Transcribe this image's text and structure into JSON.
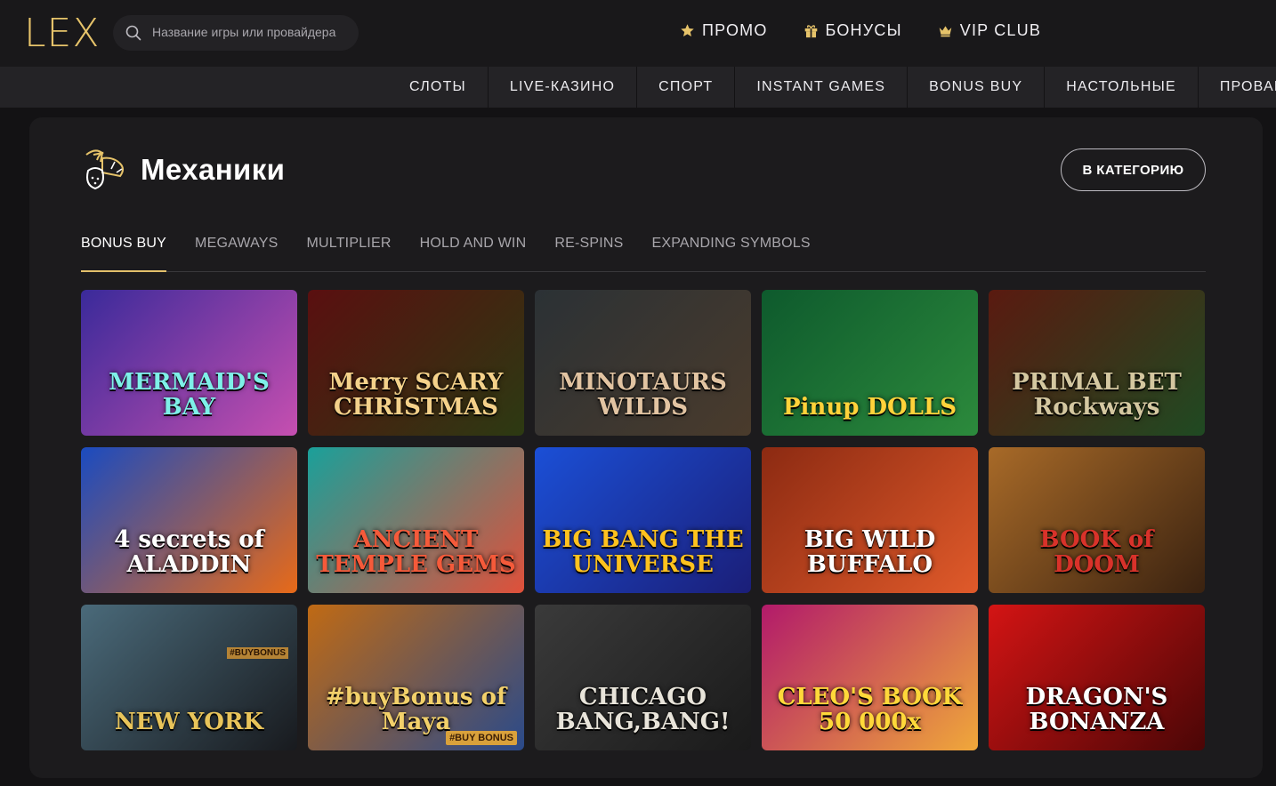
{
  "header": {
    "logo": "LEX",
    "search_placeholder": "Название игры или провайдера",
    "nav": [
      {
        "label": "ПРОМО",
        "icon": "star-icon"
      },
      {
        "label": "БОНУСЫ",
        "icon": "gift-icon"
      },
      {
        "label": "VIP CLUB",
        "icon": "crown-icon"
      }
    ],
    "accent": "#e6c36a"
  },
  "categories": [
    "СЛОТЫ",
    "LIVE-КАЗИНО",
    "СПОРТ",
    "INSTANT GAMES",
    "BONUS BUY",
    "НАСТОЛЬНЫЕ",
    "ПРОВАЙДЕ"
  ],
  "section": {
    "title": "Механики",
    "icon": "mechanics-fruit-icon",
    "category_button": "В КАТЕГОРИЮ",
    "tabs": [
      "BONUS BUY",
      "MEGAWAYS",
      "MULTIPLIER",
      "HOLD AND WIN",
      "RE-SPINS",
      "EXPANDING SYMBOLS"
    ],
    "active_tab": "BONUS BUY"
  },
  "games": [
    {
      "title": "MERMAID'S BAY",
      "bg1": "#3a2a9a",
      "bg2": "#c64fb0",
      "text": "#7ef0e8"
    },
    {
      "title": "Merry SCARY CHRISTMAS",
      "bg1": "#5a0f10",
      "bg2": "#2c3a12",
      "text": "#f4d18a"
    },
    {
      "title": "MINOTAURS WILDS",
      "bg1": "#2b3135",
      "bg2": "#4a3b2c",
      "text": "#e2c4a2"
    },
    {
      "title": "Pinup DOLLS",
      "bg1": "#0e5a2d",
      "bg2": "#2c8a3c",
      "text": "#ffd23a"
    },
    {
      "title": "PRIMAL BET Rockways",
      "bg1": "#5a1a10",
      "bg2": "#1f4a22",
      "text": "#d4c7a0"
    },
    {
      "title": "4 secrets of ALADDIN",
      "bg1": "#1a4bc0",
      "bg2": "#e86a18",
      "text": "#ffffff"
    },
    {
      "title": "ANCIENT TEMPLE GEMS",
      "bg1": "#1aa09a",
      "bg2": "#e0503a",
      "text": "#f55a3a"
    },
    {
      "title": "BIG BANG THE UNIVERSE",
      "bg1": "#1b4fd6",
      "bg2": "#1b1e78",
      "text": "#ffc21e"
    },
    {
      "title": "BIG WILD BUFFALO",
      "bg1": "#8c2a12",
      "bg2": "#e05a2a",
      "text": "#ffffff"
    },
    {
      "title": "BOOK of DOOM",
      "bg1": "#a86a28",
      "bg2": "#3a2210",
      "text": "#d8322a"
    },
    {
      "title": "NEW YORK",
      "bg1": "#4a6a7a",
      "bg2": "#181a1e",
      "text": "#e8c45a",
      "tag": "#BUYBONUS"
    },
    {
      "title": "#buyBonus of Maya",
      "bg1": "#c06a14",
      "bg2": "#2a4a8a",
      "text": "#f2d06a",
      "badge": "#BUY BONUS"
    },
    {
      "title": "CHICAGO BANG,BANG!",
      "bg1": "#3a3a3a",
      "bg2": "#1a1a1a",
      "text": "#e8e4da"
    },
    {
      "title": "CLEO'S BOOK 50 000x",
      "bg1": "#b21a6a",
      "bg2": "#f0a83a",
      "text": "#ffd83a"
    },
    {
      "title": "DRAGON'S BONANZA",
      "bg1": "#d41414",
      "bg2": "#4a0606",
      "text": "#ffffff"
    }
  ]
}
